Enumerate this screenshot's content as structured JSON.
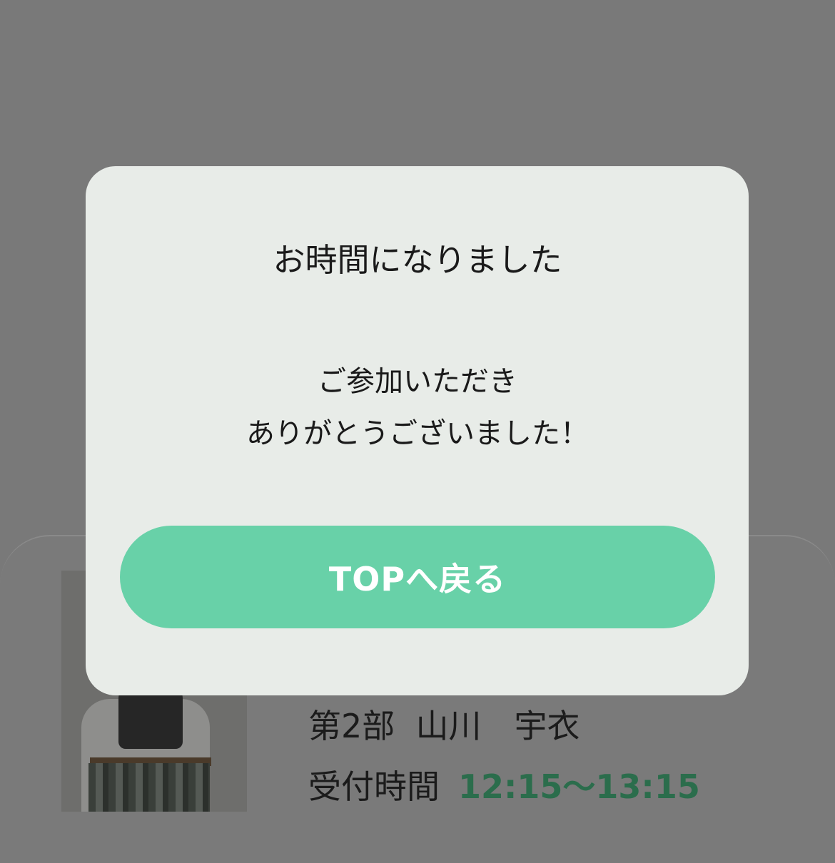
{
  "modal": {
    "title": "お時間になりました",
    "message_line1": "ご参加いただき",
    "message_line2": "ありがとうございました！",
    "button_label": "TOPへ戻る"
  },
  "session": {
    "part": "第2部",
    "member_name": "山川　宇衣",
    "reception_label": "受付時間",
    "reception_time": "12:15〜13:15"
  },
  "colors": {
    "overlay": "#797979",
    "modal_bg": "#e8ece8",
    "button": "#68d1a8",
    "time_accent": "#2b6d4c"
  }
}
